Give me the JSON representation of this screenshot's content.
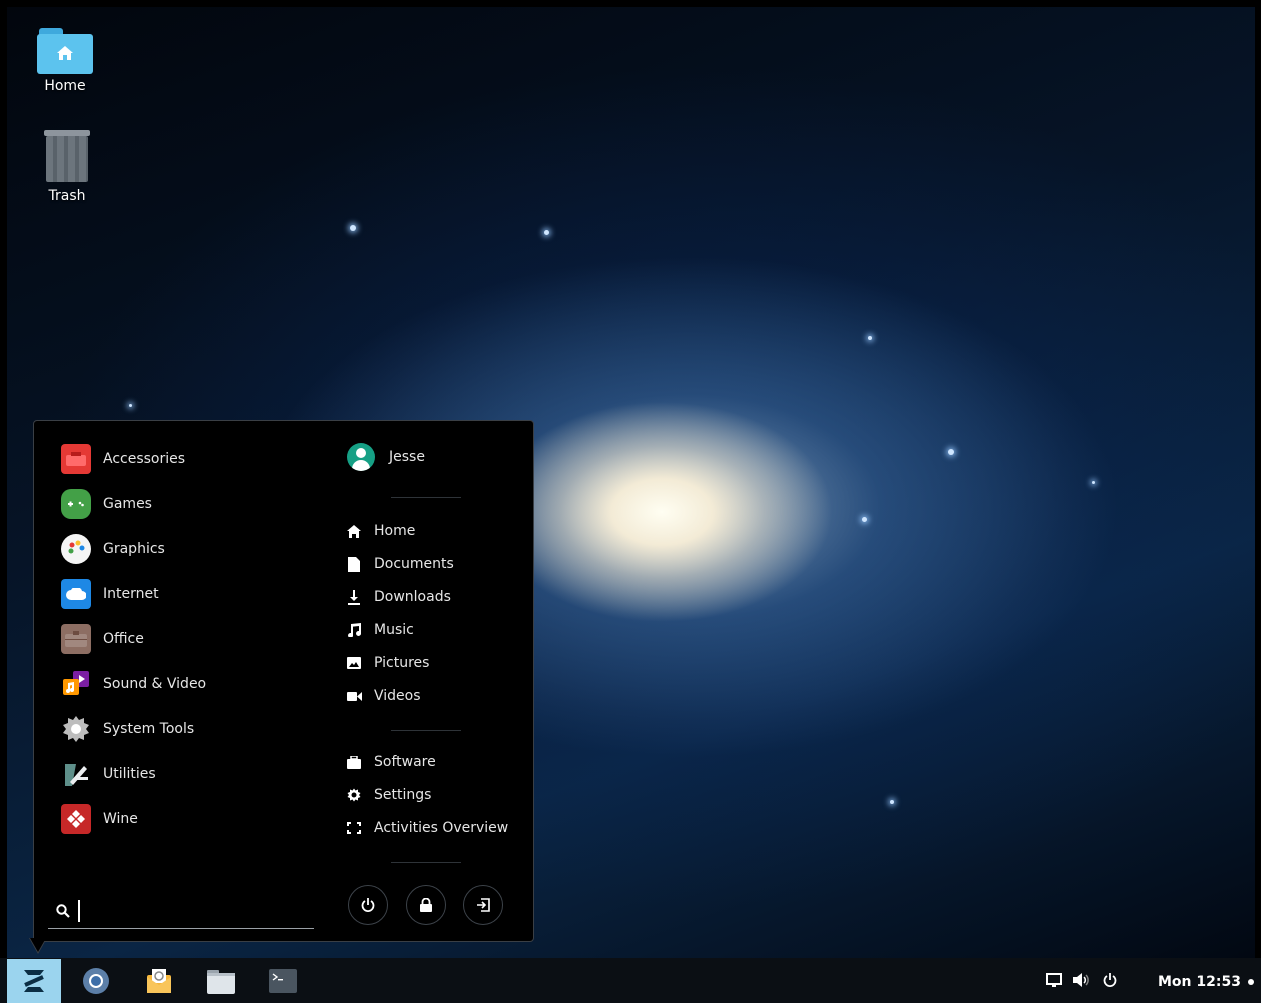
{
  "desktop": {
    "icons": [
      {
        "label": "Home",
        "icon": "home-folder-icon"
      },
      {
        "label": "Trash",
        "icon": "trash-icon"
      }
    ]
  },
  "menu": {
    "categories": [
      {
        "label": "Accessories",
        "icon": "accessories-icon",
        "color": "#e53935"
      },
      {
        "label": "Games",
        "icon": "gamepad-icon",
        "color": "#43a047"
      },
      {
        "label": "Graphics",
        "icon": "palette-icon",
        "color": "#f5f5f5"
      },
      {
        "label": "Internet",
        "icon": "cloud-icon",
        "color": "#1e88e5"
      },
      {
        "label": "Office",
        "icon": "briefcase-icon",
        "color": "#8d6e63"
      },
      {
        "label": "Sound & Video",
        "icon": "music-video-icon",
        "color": "#ff9800"
      },
      {
        "label": "System Tools",
        "icon": "gear-icon",
        "color": "#9e9e9e"
      },
      {
        "label": "Utilities",
        "icon": "utilities-icon",
        "color": "#5e8f8a"
      },
      {
        "label": "Wine",
        "icon": "wine-icon",
        "color": "#c62828"
      }
    ],
    "user": {
      "name": "Jesse"
    },
    "places": [
      {
        "label": "Home",
        "icon": "home-icon"
      },
      {
        "label": "Documents",
        "icon": "document-icon"
      },
      {
        "label": "Downloads",
        "icon": "download-icon"
      },
      {
        "label": "Music",
        "icon": "music-note-icon"
      },
      {
        "label": "Pictures",
        "icon": "picture-icon"
      },
      {
        "label": "Videos",
        "icon": "video-camera-icon"
      }
    ],
    "system": [
      {
        "label": "Software",
        "icon": "software-bag-icon"
      },
      {
        "label": "Settings",
        "icon": "settings-gear-icon"
      },
      {
        "label": "Activities Overview",
        "icon": "activities-overview-icon"
      }
    ],
    "session_buttons": [
      {
        "icon": "power-icon"
      },
      {
        "icon": "lock-icon"
      },
      {
        "icon": "logout-icon"
      }
    ],
    "search": {
      "value": "",
      "placeholder": ""
    }
  },
  "taskbar": {
    "apps": [
      {
        "icon": "chromium-browser-icon"
      },
      {
        "icon": "mail-client-icon"
      },
      {
        "icon": "files-icon"
      },
      {
        "icon": "terminal-icon"
      }
    ],
    "tray": [
      {
        "icon": "display-icon"
      },
      {
        "icon": "volume-icon"
      },
      {
        "icon": "power-icon"
      }
    ],
    "clock": "Mon 12:53"
  },
  "colors": {
    "accent": "#9bd4ee",
    "menu_bg": "#000000",
    "avatar": "#16a085"
  }
}
